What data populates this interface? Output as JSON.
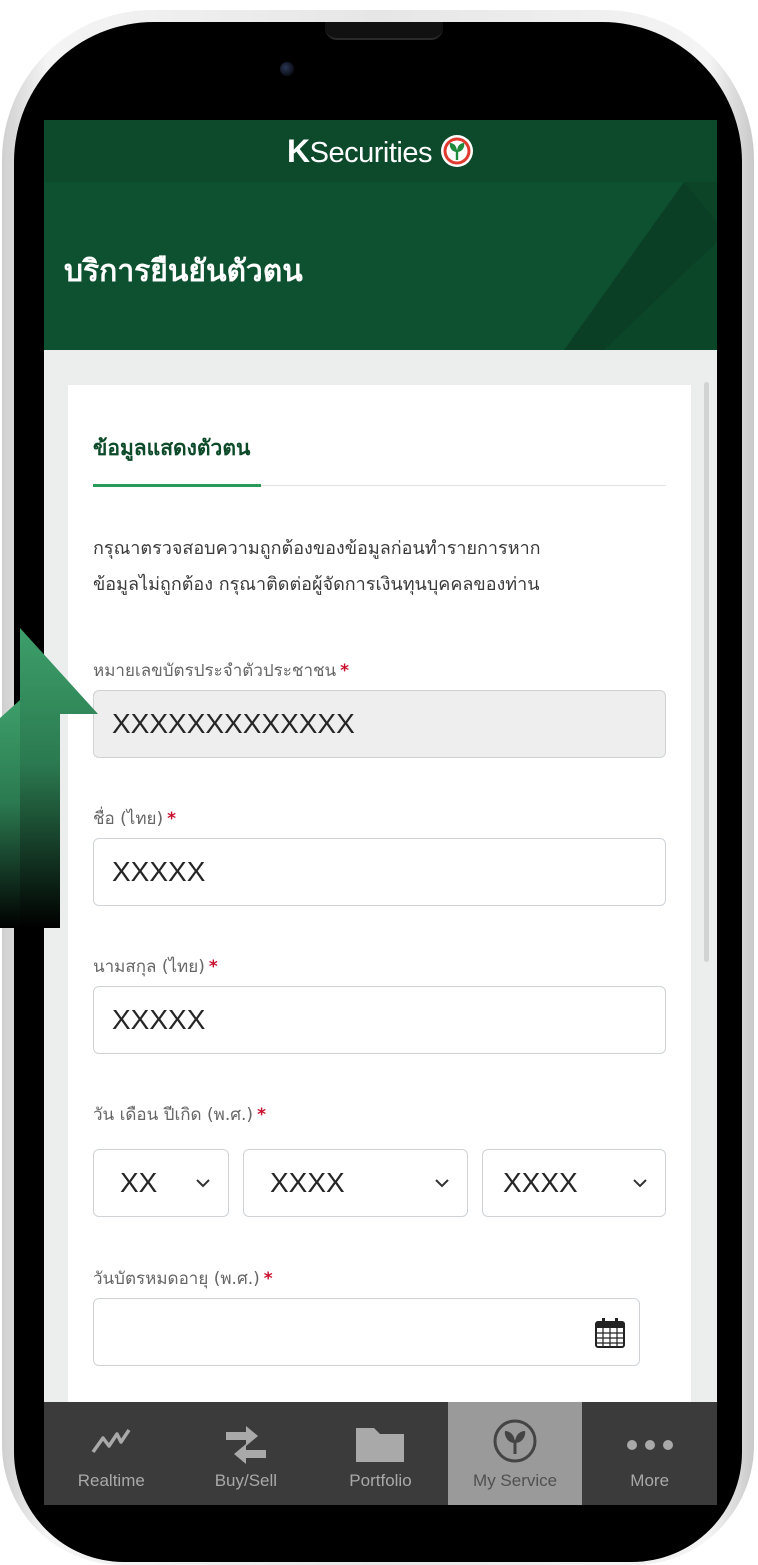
{
  "app": {
    "brand_k": "K",
    "brand_rest": "Securities"
  },
  "header": {
    "title": "บริการยืนยันตัวตน"
  },
  "form": {
    "section_title": "ข้อมูลแสดงตัวตน",
    "description_line1": "กรุณาตรวจสอบความถูกต้องของข้อมูลก่อนทำรายการหาก",
    "description_line2": "ข้อมูลไม่ถูกต้อง กรุณาติดต่อผู้จัดการเงินทุนบุคคลของท่าน",
    "required_mark": "*",
    "id_card": {
      "label": "หมายเลขบัตรประจำตัวประชาชน",
      "value": "XXXXXXXXXXXXX"
    },
    "first_name": {
      "label": "ชื่อ (ไทย)",
      "value": "XXXXX"
    },
    "last_name": {
      "label": "นามสกุล (ไทย)",
      "value": "XXXXX"
    },
    "birth_date": {
      "label": "วัน เดือน ปีเกิด (พ.ศ.)",
      "day": "XX",
      "month": "XXXX",
      "year": "XXXX"
    },
    "card_expiry": {
      "label": "วันบัตรหมดอายุ (พ.ศ.)",
      "value": "",
      "icon": "calendar-icon"
    }
  },
  "tabs": [
    {
      "label": "Realtime",
      "icon": "chart-line-icon",
      "active": false
    },
    {
      "label": "Buy/Sell",
      "icon": "transfer-arrows-icon",
      "active": false
    },
    {
      "label": "Portfolio",
      "icon": "folder-icon",
      "active": false
    },
    {
      "label": "My Service",
      "icon": "kasikorn-leaf-icon",
      "active": true
    },
    {
      "label": "More",
      "icon": "more-dots-icon",
      "active": false
    }
  ],
  "colors": {
    "brand_dark_green": "#0d4a2b",
    "hero_green": "#0e5130",
    "accent_green": "#2a9a5b",
    "required_red": "#c8102e",
    "tabbar": "#3b3b3b",
    "tab_active": "#9a9a9a"
  }
}
